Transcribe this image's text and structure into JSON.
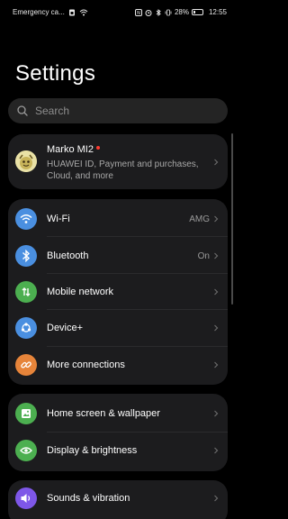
{
  "status_bar": {
    "carrier": "Emergency ca...",
    "battery_percent": "28%",
    "battery_level": 0.28,
    "time": "12:55",
    "icons": [
      "sim-icon",
      "wifi-icon",
      "nfc-icon",
      "alarm-icon",
      "bluetooth-icon",
      "vibrate-icon",
      "battery-icon"
    ]
  },
  "page": {
    "title": "Settings"
  },
  "search": {
    "placeholder": "Search"
  },
  "profile": {
    "name": "Marko MI2",
    "subtitle": "HUAWEI ID, Payment and purchases, Cloud, and more"
  },
  "groups": {
    "connectivity": [
      {
        "label": "Wi-Fi",
        "value": "AMG",
        "icon": "wifi-icon",
        "color": "#4a8fe0"
      },
      {
        "label": "Bluetooth",
        "value": "On",
        "icon": "bluetooth-icon",
        "color": "#4a8fe0"
      },
      {
        "label": "Mobile network",
        "value": "",
        "icon": "mobile-network-icon",
        "color": "#4caf50"
      },
      {
        "label": "Device+",
        "value": "",
        "icon": "device-plus-icon",
        "color": "#4a8fe0"
      },
      {
        "label": "More connections",
        "value": "",
        "icon": "link-icon",
        "color": "#e6843a"
      }
    ],
    "display": [
      {
        "label": "Home screen & wallpaper",
        "icon": "wallpaper-icon",
        "color": "#4caf50"
      },
      {
        "label": "Display & brightness",
        "icon": "eye-icon",
        "color": "#4caf50"
      }
    ],
    "sound": [
      {
        "label": "Sounds & vibration",
        "icon": "volume-icon",
        "color": "#7e57e8"
      }
    ]
  }
}
